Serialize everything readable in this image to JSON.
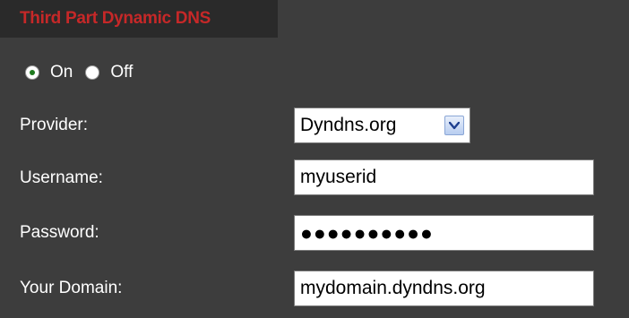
{
  "header": {
    "title": "Third Part Dynamic DNS"
  },
  "status": {
    "options": [
      {
        "label": "On",
        "selected": true
      },
      {
        "label": "Off",
        "selected": false
      }
    ]
  },
  "form": {
    "provider": {
      "label": "Provider:",
      "value": "Dyndns.org",
      "icon": "chevron-down-icon"
    },
    "username": {
      "label": "Username:",
      "value": "myuserid"
    },
    "password": {
      "label": "Password:",
      "masked_value": "●●●●●●●●●●"
    },
    "domain": {
      "label": "Your Domain:",
      "value": "mydomain.dyndns.org"
    }
  },
  "colors": {
    "panel_bg": "#3d3d3d",
    "title_bg": "#2a2a2a",
    "title_text": "#c62828",
    "label_text": "#ffffff"
  }
}
